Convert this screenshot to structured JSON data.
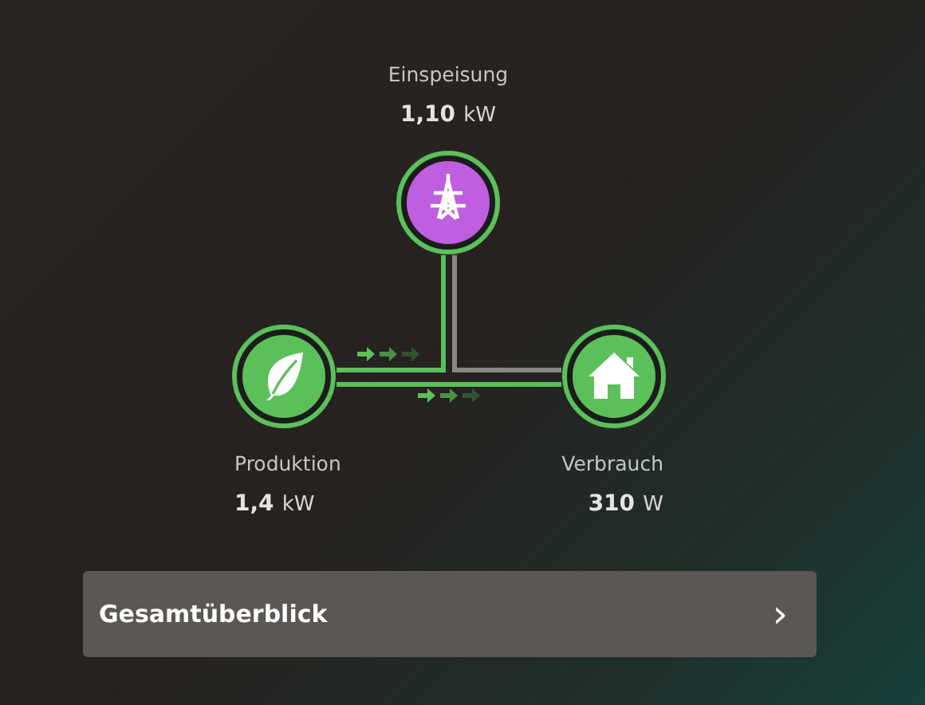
{
  "nodes": [
    {
      "kind": "grid",
      "label": "Einspeisung",
      "value": "1,10",
      "unit": "kW",
      "color": "#c05ee0"
    },
    {
      "kind": "solar",
      "label": "Produktion",
      "value": "1,4",
      "unit": "kW",
      "color": "#5cc05a"
    },
    {
      "kind": "home",
      "label": "Verbrauch",
      "value": "310",
      "unit": "W",
      "color": "#5cc05a"
    }
  ],
  "overview_button": {
    "label": "Gesamtüberblick",
    "chevron": "›"
  }
}
